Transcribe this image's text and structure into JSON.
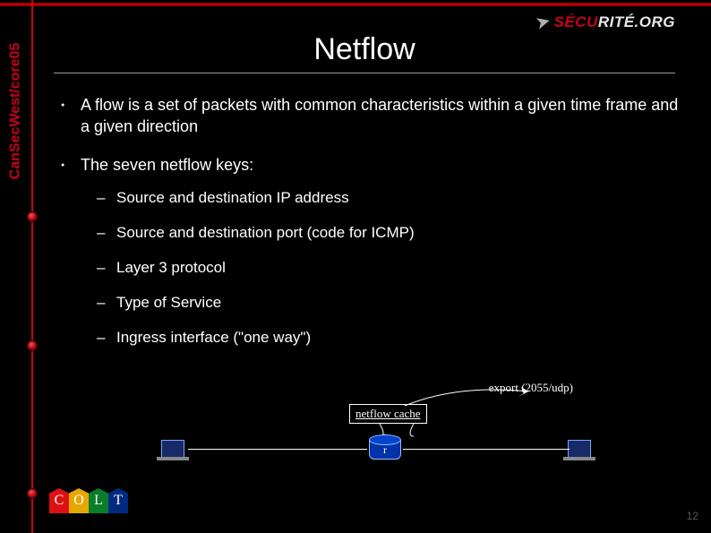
{
  "brand": {
    "text_a": "SÉCU",
    "text_b": "RITÉ.ORG"
  },
  "sidebar": {
    "conference": "CanSecWest/core05"
  },
  "slide": {
    "title": "Netflow",
    "bullets": [
      "A flow is a set of packets with common characteristics within a given time frame and a given direction",
      "The seven netflow keys:"
    ],
    "subbullets": [
      "Source and destination IP address",
      "Source and destination port (code for ICMP)",
      "Layer 3 protocol",
      "Type of Service",
      "Ingress interface (\"one way\")"
    ]
  },
  "diagram": {
    "export_label": "export (2055/udp)",
    "cache_label": "netflow cache",
    "router_letter": "r"
  },
  "footer": {
    "sponsor_letters": [
      "C",
      "O",
      "L",
      "T"
    ],
    "pagenum": "12"
  }
}
